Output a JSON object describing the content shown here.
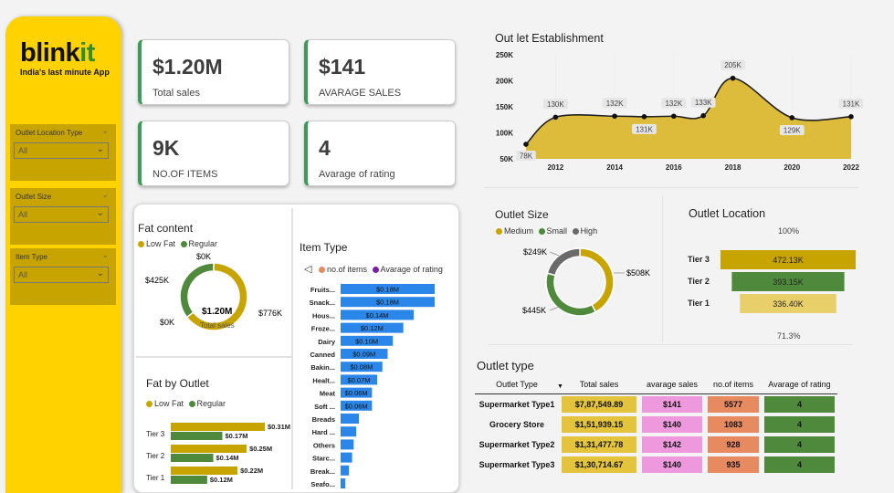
{
  "brand": {
    "name_a": "blink",
    "name_b": "it",
    "tagline": "India's last minute App"
  },
  "slicers": [
    {
      "title": "Outlet Location Type",
      "value": "All"
    },
    {
      "title": "Outlet Size",
      "value": "All"
    },
    {
      "title": "Item Type",
      "value": "All"
    }
  ],
  "kpis": [
    {
      "value": "$1.20M",
      "label": "Total sales"
    },
    {
      "value": "$141",
      "label": "AVARAGE SALES"
    },
    {
      "value": "9K",
      "label": "NO.OF ITEMS"
    },
    {
      "value": "4",
      "label": "Avarage of rating"
    }
  ],
  "colors": {
    "gold": "#c8a400",
    "green": "#4f8a3c",
    "grey": "#6a6a6a",
    "blue": "#2a86e8",
    "pink": "#ee99dd",
    "salmon": "#e88a60",
    "yellow": "#ffd200"
  },
  "fat_content": {
    "title": "Fat content",
    "legend": [
      "Low Fat",
      "Regular"
    ],
    "center_value": "$1.20M",
    "center_label": "Total sales",
    "labels": [
      "$0K",
      "$425K",
      "$0K",
      "$776K"
    ]
  },
  "item_type": {
    "title": "Item Type",
    "legend": [
      "no.of items",
      "Avarage of rating"
    ]
  },
  "fat_by_outlet": {
    "title": "Fat by Outlet",
    "legend": [
      "Low Fat",
      "Regular"
    ]
  },
  "outlet_size": {
    "title": "Outlet Size",
    "legend": [
      "Medium",
      "Small",
      "High"
    ],
    "labels": [
      "$249K",
      "$508K",
      "$445K"
    ]
  },
  "outlet_location": {
    "title": "Outlet Location",
    "top_label": "100%",
    "bottom_label": "71.3%"
  },
  "outlet_establishment": {
    "title": "Out let Establishment"
  },
  "outlet_type": {
    "title": "Outlet type",
    "headers": [
      "Outlet Type",
      "Total sales",
      "avarage sales",
      "no.of items",
      "Avarage of rating"
    ],
    "rows": [
      {
        "type": "Supermarket Type1",
        "sales": "$7,87,549.89",
        "avg": "$141",
        "items": "5577",
        "rating": "4"
      },
      {
        "type": "Grocery Store",
        "sales": "$1,51,939.15",
        "avg": "$140",
        "items": "1083",
        "rating": "4"
      },
      {
        "type": "Supermarket Type2",
        "sales": "$1,31,477.78",
        "avg": "$142",
        "items": "928",
        "rating": "4"
      },
      {
        "type": "Supermarket Type3",
        "sales": "$1,30,714.67",
        "avg": "$140",
        "items": "935",
        "rating": "4"
      }
    ]
  },
  "chart_data": [
    {
      "type": "area",
      "x": [
        2011,
        2012,
        2014,
        2015,
        2016,
        2017,
        2018,
        2020,
        2022
      ],
      "values": [
        78,
        130,
        132,
        131,
        132,
        133,
        205,
        129,
        131
      ],
      "point_labels": [
        "78K",
        "130K",
        "132K",
        "131K",
        "132K",
        "133K",
        "205K",
        "129K",
        "131K"
      ],
      "x_ticks": [
        "2012",
        "2014",
        "2016",
        "2018",
        "2020",
        "2022"
      ],
      "y_ticks": [
        "50K",
        "100K",
        "150K",
        "200K",
        "250K"
      ],
      "ylim": [
        50,
        250
      ],
      "xlim": [
        2011,
        2022
      ]
    },
    {
      "type": "pie",
      "categories": [
        "Low Fat",
        "Regular"
      ],
      "values": [
        776,
        425
      ]
    },
    {
      "type": "bar",
      "orientation": "horizontal",
      "categories": [
        "Fruits...",
        "Snack...",
        "Hous...",
        "Froze...",
        "Dairy",
        "Canned",
        "Bakin...",
        "Healt...",
        "Meat",
        "Soft ...",
        "Breads",
        "Hard ...",
        "Others",
        "Starc...",
        "Break...",
        "Seafo..."
      ],
      "values": [
        0.18,
        0.18,
        0.14,
        0.12,
        0.1,
        0.09,
        0.08,
        0.07,
        0.06,
        0.06,
        0.035,
        0.03,
        0.025,
        0.022,
        0.016,
        0.009
      ],
      "data_labels": [
        "$0.18M",
        "$0.18M",
        "$0.14M",
        "$0.12M",
        "$0.10M",
        "$0.09M",
        "$0.08M",
        "$0.07M",
        "$0.06M",
        "$0.06M",
        "",
        "",
        "",
        "",
        "",
        ""
      ]
    },
    {
      "type": "bar",
      "orientation": "horizontal",
      "categories": [
        "Tier 3",
        "Tier 2",
        "Tier 1"
      ],
      "series": [
        {
          "name": "Low Fat",
          "values": [
            0.31,
            0.25,
            0.22
          ],
          "labels": [
            "$0.31M",
            "$0.25M",
            "$0.22M"
          ]
        },
        {
          "name": "Regular",
          "values": [
            0.17,
            0.14,
            0.12
          ],
          "labels": [
            "$0.17M",
            "$0.14M",
            "$0.12M"
          ]
        }
      ]
    },
    {
      "type": "pie",
      "categories": [
        "Medium",
        "Small",
        "High"
      ],
      "values": [
        508,
        445,
        249
      ]
    },
    {
      "type": "bar",
      "orientation": "horizontal",
      "categories": [
        "Tier 3",
        "Tier 2",
        "Tier 1"
      ],
      "values": [
        472.13,
        393.15,
        336.4
      ],
      "data_labels": [
        "472.13K",
        "393.15K",
        "336.40K"
      ]
    }
  ]
}
